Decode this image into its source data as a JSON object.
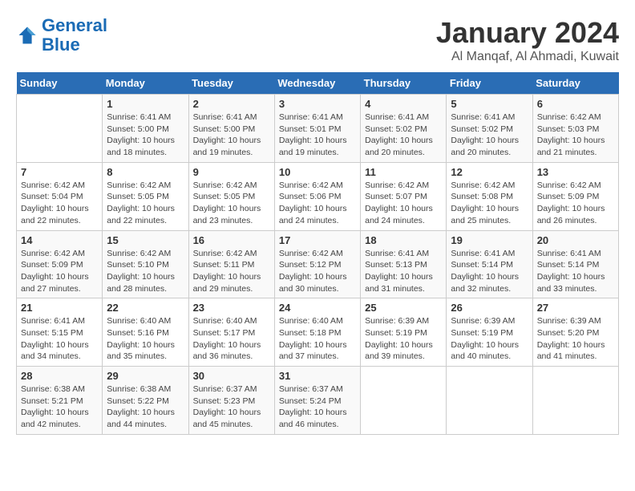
{
  "header": {
    "logo_line1": "General",
    "logo_line2": "Blue",
    "title": "January 2024",
    "subtitle": "Al Manqaf, Al Ahmadi, Kuwait"
  },
  "calendar": {
    "days_of_week": [
      "Sunday",
      "Monday",
      "Tuesday",
      "Wednesday",
      "Thursday",
      "Friday",
      "Saturday"
    ],
    "weeks": [
      [
        {
          "day": "",
          "info": ""
        },
        {
          "day": "1",
          "info": "Sunrise: 6:41 AM\nSunset: 5:00 PM\nDaylight: 10 hours\nand 18 minutes."
        },
        {
          "day": "2",
          "info": "Sunrise: 6:41 AM\nSunset: 5:00 PM\nDaylight: 10 hours\nand 19 minutes."
        },
        {
          "day": "3",
          "info": "Sunrise: 6:41 AM\nSunset: 5:01 PM\nDaylight: 10 hours\nand 19 minutes."
        },
        {
          "day": "4",
          "info": "Sunrise: 6:41 AM\nSunset: 5:02 PM\nDaylight: 10 hours\nand 20 minutes."
        },
        {
          "day": "5",
          "info": "Sunrise: 6:41 AM\nSunset: 5:02 PM\nDaylight: 10 hours\nand 20 minutes."
        },
        {
          "day": "6",
          "info": "Sunrise: 6:42 AM\nSunset: 5:03 PM\nDaylight: 10 hours\nand 21 minutes."
        }
      ],
      [
        {
          "day": "7",
          "info": "Sunrise: 6:42 AM\nSunset: 5:04 PM\nDaylight: 10 hours\nand 22 minutes."
        },
        {
          "day": "8",
          "info": "Sunrise: 6:42 AM\nSunset: 5:05 PM\nDaylight: 10 hours\nand 22 minutes."
        },
        {
          "day": "9",
          "info": "Sunrise: 6:42 AM\nSunset: 5:05 PM\nDaylight: 10 hours\nand 23 minutes."
        },
        {
          "day": "10",
          "info": "Sunrise: 6:42 AM\nSunset: 5:06 PM\nDaylight: 10 hours\nand 24 minutes."
        },
        {
          "day": "11",
          "info": "Sunrise: 6:42 AM\nSunset: 5:07 PM\nDaylight: 10 hours\nand 24 minutes."
        },
        {
          "day": "12",
          "info": "Sunrise: 6:42 AM\nSunset: 5:08 PM\nDaylight: 10 hours\nand 25 minutes."
        },
        {
          "day": "13",
          "info": "Sunrise: 6:42 AM\nSunset: 5:09 PM\nDaylight: 10 hours\nand 26 minutes."
        }
      ],
      [
        {
          "day": "14",
          "info": "Sunrise: 6:42 AM\nSunset: 5:09 PM\nDaylight: 10 hours\nand 27 minutes."
        },
        {
          "day": "15",
          "info": "Sunrise: 6:42 AM\nSunset: 5:10 PM\nDaylight: 10 hours\nand 28 minutes."
        },
        {
          "day": "16",
          "info": "Sunrise: 6:42 AM\nSunset: 5:11 PM\nDaylight: 10 hours\nand 29 minutes."
        },
        {
          "day": "17",
          "info": "Sunrise: 6:42 AM\nSunset: 5:12 PM\nDaylight: 10 hours\nand 30 minutes."
        },
        {
          "day": "18",
          "info": "Sunrise: 6:41 AM\nSunset: 5:13 PM\nDaylight: 10 hours\nand 31 minutes."
        },
        {
          "day": "19",
          "info": "Sunrise: 6:41 AM\nSunset: 5:14 PM\nDaylight: 10 hours\nand 32 minutes."
        },
        {
          "day": "20",
          "info": "Sunrise: 6:41 AM\nSunset: 5:14 PM\nDaylight: 10 hours\nand 33 minutes."
        }
      ],
      [
        {
          "day": "21",
          "info": "Sunrise: 6:41 AM\nSunset: 5:15 PM\nDaylight: 10 hours\nand 34 minutes."
        },
        {
          "day": "22",
          "info": "Sunrise: 6:40 AM\nSunset: 5:16 PM\nDaylight: 10 hours\nand 35 minutes."
        },
        {
          "day": "23",
          "info": "Sunrise: 6:40 AM\nSunset: 5:17 PM\nDaylight: 10 hours\nand 36 minutes."
        },
        {
          "day": "24",
          "info": "Sunrise: 6:40 AM\nSunset: 5:18 PM\nDaylight: 10 hours\nand 37 minutes."
        },
        {
          "day": "25",
          "info": "Sunrise: 6:39 AM\nSunset: 5:19 PM\nDaylight: 10 hours\nand 39 minutes."
        },
        {
          "day": "26",
          "info": "Sunrise: 6:39 AM\nSunset: 5:19 PM\nDaylight: 10 hours\nand 40 minutes."
        },
        {
          "day": "27",
          "info": "Sunrise: 6:39 AM\nSunset: 5:20 PM\nDaylight: 10 hours\nand 41 minutes."
        }
      ],
      [
        {
          "day": "28",
          "info": "Sunrise: 6:38 AM\nSunset: 5:21 PM\nDaylight: 10 hours\nand 42 minutes."
        },
        {
          "day": "29",
          "info": "Sunrise: 6:38 AM\nSunset: 5:22 PM\nDaylight: 10 hours\nand 44 minutes."
        },
        {
          "day": "30",
          "info": "Sunrise: 6:37 AM\nSunset: 5:23 PM\nDaylight: 10 hours\nand 45 minutes."
        },
        {
          "day": "31",
          "info": "Sunrise: 6:37 AM\nSunset: 5:24 PM\nDaylight: 10 hours\nand 46 minutes."
        },
        {
          "day": "",
          "info": ""
        },
        {
          "day": "",
          "info": ""
        },
        {
          "day": "",
          "info": ""
        }
      ]
    ]
  }
}
